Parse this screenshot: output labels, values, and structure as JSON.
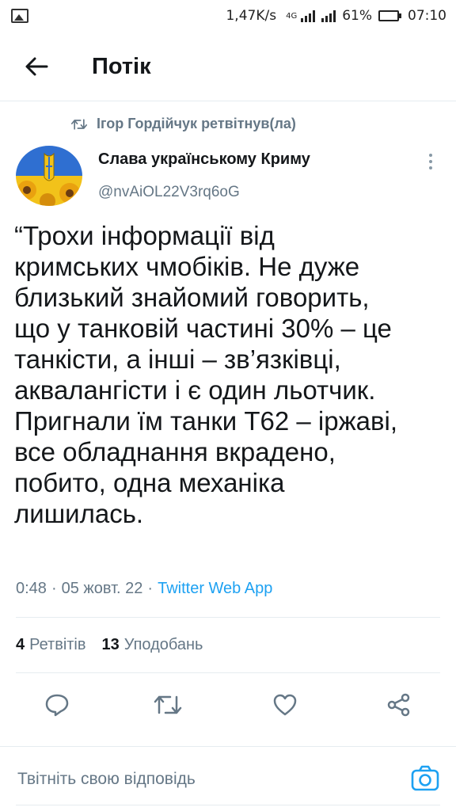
{
  "status_bar": {
    "net_speed": "1,47K/s",
    "network": "4G",
    "battery": "61%",
    "battery_level": 0.61,
    "time": "07:10"
  },
  "header": {
    "title": "Потік"
  },
  "retweet": {
    "text": "Ігор Гордійчук ретвітнув(ла)"
  },
  "tweet": {
    "author_name": "Слава українському Криму",
    "author_handle": "@nvAiOL22V3rq6oG",
    "text": "“Трохи інформації від\nкримських чмобіків. Не дуже\nблизький знайомий говорить,\nщо у танковій частині 30% – це\nтанкісти, а інші – зв’язківці,\nаквалангісти і є один льотчик.\nПригнали їм танки Т62 – іржаві,\nвсе обладнання вкрадено,\nпобито, одна механіка\nлишилась.",
    "time": "0:48",
    "date": "05 жовт. 22",
    "source": "Twitter Web App"
  },
  "stats": {
    "retweets_count": "4",
    "retweets_label": "Ретвітів",
    "likes_count": "13",
    "likes_label": "Уподобань"
  },
  "reply": {
    "placeholder": "Твітніть свою відповідь"
  },
  "colors": {
    "accent": "#1da1f2",
    "text": "#14171a",
    "secondary": "#657786",
    "divider": "#e6ecf0"
  }
}
